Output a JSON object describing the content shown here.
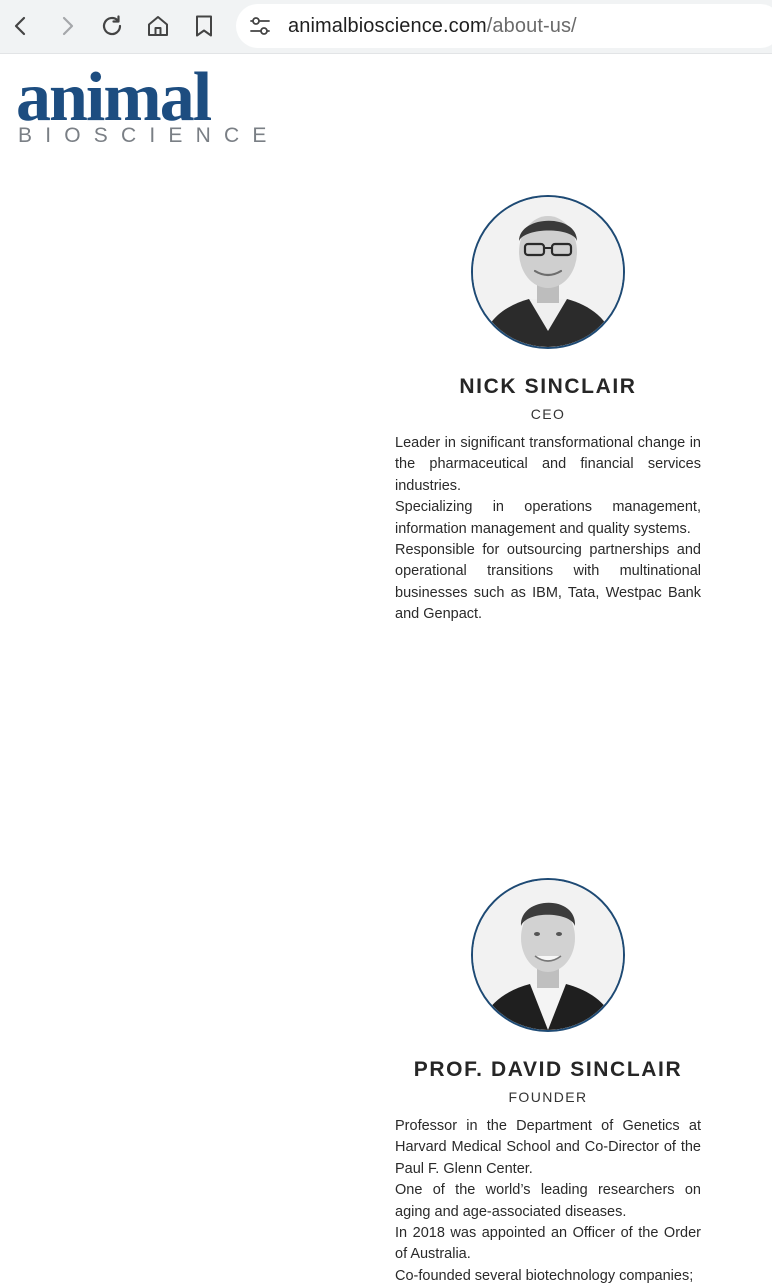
{
  "browser": {
    "url_domain": "animalbioscience.com",
    "url_path": "/about-us/"
  },
  "logo": {
    "word": "animal",
    "sub": "BIOSCIENCE"
  },
  "team": [
    {
      "name": "NICK SINCLAIR",
      "role": "CEO",
      "bio": [
        "Leader in significant transformational change in the pharmaceutical and financial services industries.",
        "Specializing in operations management, information management and quality systems.",
        "Responsible for outsourcing partnerships and operational transitions with multinational businesses such as IBM, Tata, Westpac Bank and Genpact."
      ]
    },
    {
      "name": "PROF. DAVID SINCLAIR",
      "role": "FOUNDER",
      "bio": [
        "Professor in the Department of Genetics at Harvard Medical School and Co-Director of the Paul F. Glenn Center.",
        "One of the world’s leading researchers on aging and age-associated diseases.",
        "In 2018 was appointed an Officer of the Order of Australia.",
        "Co-founded several biotechnology companies;"
      ]
    }
  ]
}
